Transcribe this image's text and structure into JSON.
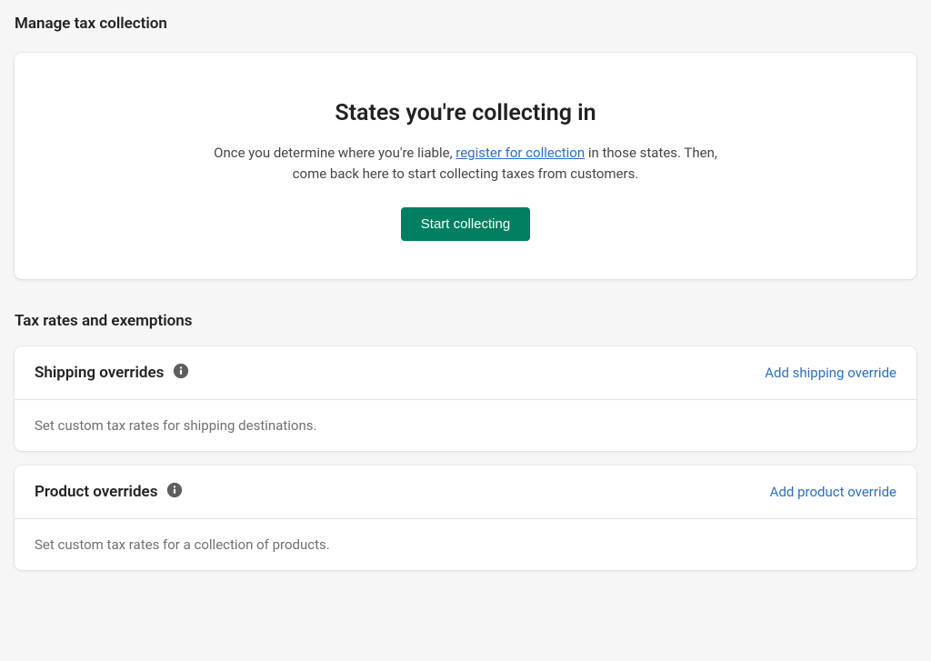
{
  "page": {
    "title": "Manage tax collection"
  },
  "hero": {
    "title": "States you're collecting in",
    "desc_part1": "Once you determine where you're liable, ",
    "link_text": "register for collection",
    "desc_part2": " in those states. Then, come back here to start collecting taxes from customers.",
    "button_label": "Start collecting"
  },
  "rates_section": {
    "title": "Tax rates and exemptions"
  },
  "shipping": {
    "title": "Shipping overrides",
    "action": "Add shipping override",
    "body": "Set custom tax rates for shipping destinations."
  },
  "product": {
    "title": "Product overrides",
    "action": "Add product override",
    "body": "Set custom tax rates for a collection of products."
  }
}
